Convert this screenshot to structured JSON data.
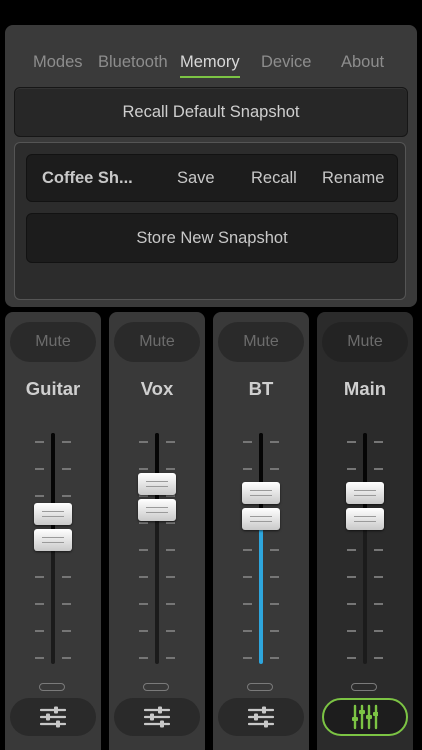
{
  "tabs": [
    {
      "label": "Modes"
    },
    {
      "label": "Bluetooth"
    },
    {
      "label": "Memory",
      "active": true
    },
    {
      "label": "Device"
    },
    {
      "label": "About"
    }
  ],
  "memory": {
    "recall_default_label": "Recall Default Snapshot",
    "snapshot": {
      "name": "Coffee Sh...",
      "save_label": "Save",
      "recall_label": "Recall",
      "rename_label": "Rename"
    },
    "store_new_label": "Store New Snapshot"
  },
  "channels": [
    {
      "name": "Guitar",
      "mute_label": "Mute",
      "level": 0.58,
      "active": false
    },
    {
      "name": "Vox",
      "mute_label": "Mute",
      "level": 0.71,
      "active": false
    },
    {
      "name": "BT",
      "mute_label": "Mute",
      "level": 0.67,
      "active": false
    },
    {
      "name": "Main",
      "mute_label": "Mute",
      "level": 0.67,
      "active": true
    }
  ],
  "colors": {
    "accent_green": "#7cc444",
    "level_blue": "#2ea6dd",
    "panel": "#3a3a3a"
  },
  "icons": {
    "eq": "sliders-icon"
  }
}
